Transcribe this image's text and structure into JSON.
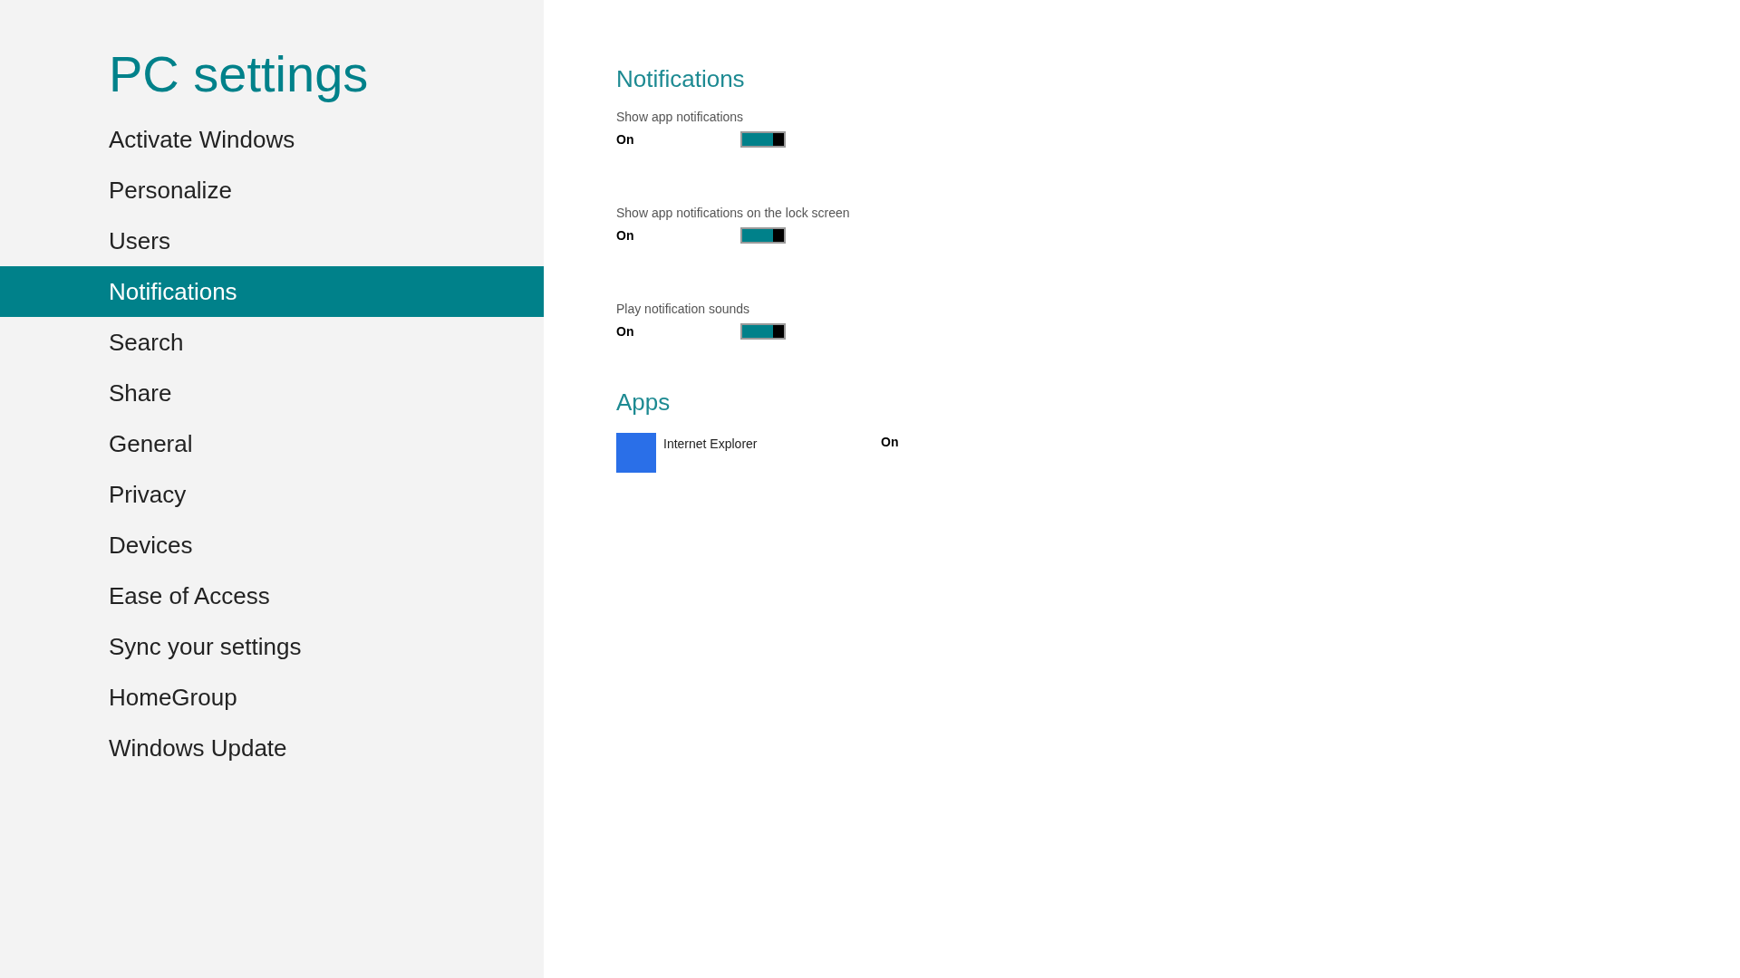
{
  "sidebar": {
    "title": "PC settings",
    "items": [
      {
        "label": "Activate Windows",
        "selected": false
      },
      {
        "label": "Personalize",
        "selected": false
      },
      {
        "label": "Users",
        "selected": false
      },
      {
        "label": "Notifications",
        "selected": true
      },
      {
        "label": "Search",
        "selected": false
      },
      {
        "label": "Share",
        "selected": false
      },
      {
        "label": "General",
        "selected": false
      },
      {
        "label": "Privacy",
        "selected": false
      },
      {
        "label": "Devices",
        "selected": false
      },
      {
        "label": "Ease of Access",
        "selected": false
      },
      {
        "label": "Sync your settings",
        "selected": false
      },
      {
        "label": "HomeGroup",
        "selected": false
      },
      {
        "label": "Windows Update",
        "selected": false
      }
    ]
  },
  "notifications": {
    "heading": "Notifications",
    "settings": [
      {
        "label": "Show app notifications",
        "state": "On",
        "on": true
      },
      {
        "label": "Show app notifications on the lock screen",
        "state": "On",
        "on": true
      },
      {
        "label": "Play notification sounds",
        "state": "On",
        "on": true
      }
    ]
  },
  "apps": {
    "heading": "Apps",
    "items": [
      {
        "name": "Internet Explorer",
        "state": "On",
        "color": "#2a6fe8"
      }
    ]
  }
}
